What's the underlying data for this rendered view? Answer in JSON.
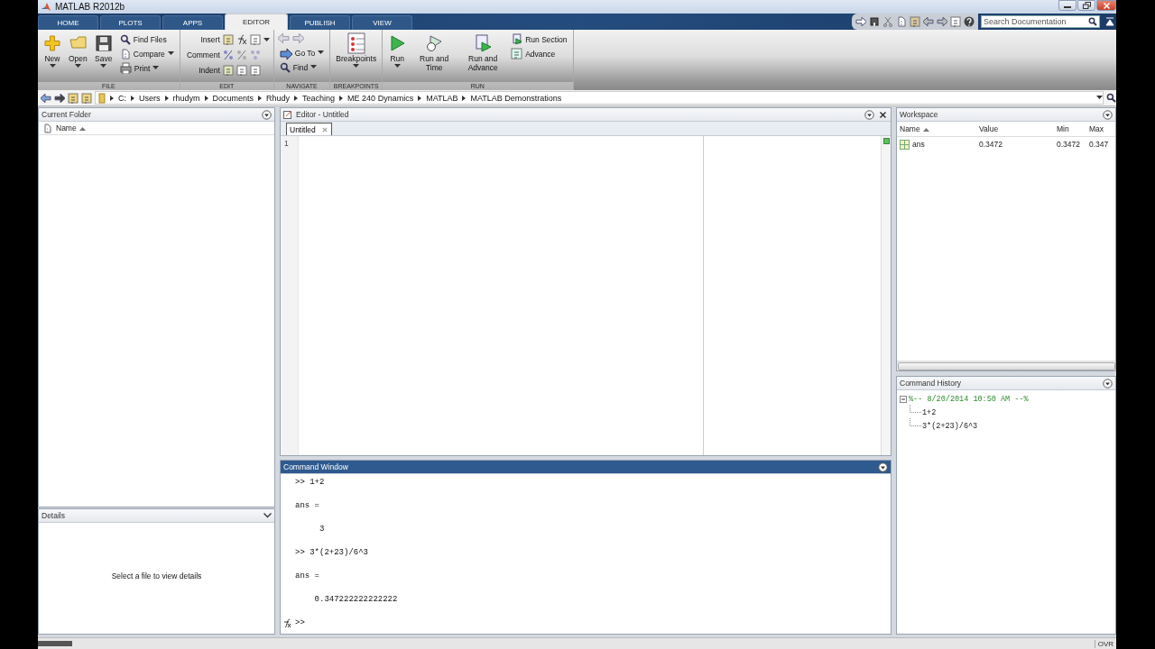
{
  "window": {
    "title": "MATLAB R2012b"
  },
  "tabs": [
    {
      "label": "HOME",
      "selected": false
    },
    {
      "label": "PLOTS",
      "selected": false
    },
    {
      "label": "APPS",
      "selected": false
    },
    {
      "label": "EDITOR",
      "selected": true
    },
    {
      "label": "PUBLISH",
      "selected": false
    },
    {
      "label": "VIEW",
      "selected": false
    }
  ],
  "search": {
    "placeholder": "Search Documentation"
  },
  "ribbon": {
    "groups": [
      {
        "label": "FILE",
        "items": [
          {
            "kind": "large",
            "label": "New",
            "caret": true
          },
          {
            "kind": "large",
            "label": "Open",
            "caret": true
          },
          {
            "kind": "large",
            "label": "Save",
            "caret": true
          },
          {
            "kind": "stack",
            "items": [
              {
                "label": "Find Files",
                "caret": false
              },
              {
                "label": "Compare",
                "caret": true
              },
              {
                "label": "Print",
                "caret": true
              }
            ]
          }
        ]
      },
      {
        "label": "EDIT",
        "items": [
          {
            "kind": "rows",
            "items": [
              {
                "label": "Insert",
                "caret": true
              },
              {
                "label": "Comment",
                "caret": false
              },
              {
                "label": "Indent",
                "caret": false
              }
            ]
          }
        ]
      },
      {
        "label": "NAVIGATE",
        "items": [
          {
            "kind": "stack",
            "items": [
              {
                "label": "Go To",
                "caret": true
              },
              {
                "label": "Find",
                "caret": true
              }
            ]
          }
        ]
      },
      {
        "label": "BREAKPOINTS",
        "items": [
          {
            "kind": "large",
            "label": "Breakpoints",
            "caret": true
          }
        ]
      },
      {
        "label": "RUN",
        "items": [
          {
            "kind": "large",
            "label": "Run",
            "caret": true
          },
          {
            "kind": "large",
            "label": "Run and Time",
            "caret": false
          },
          {
            "kind": "large",
            "label": "Run and Advance",
            "caret": false
          },
          {
            "kind": "stack",
            "items": [
              {
                "label": "Run Section",
                "caret": false
              },
              {
                "label": "Advance",
                "caret": false
              }
            ]
          }
        ]
      }
    ]
  },
  "address_bar": {
    "path": [
      "C:",
      "Users",
      "rhudym",
      "Documents",
      "Rhudy",
      "Teaching",
      "ME 240 Dynamics",
      "MATLAB",
      "MATLAB Demonstrations"
    ]
  },
  "current_folder": {
    "title": "Current Folder",
    "columns": [
      {
        "label": "Name",
        "sorted": true
      }
    ]
  },
  "details": {
    "title": "Details",
    "message": "Select a file to view details"
  },
  "editor": {
    "title": "Editor - Untitled",
    "tabs": [
      {
        "label": "Untitled",
        "selected": true
      }
    ],
    "line_numbers": [
      "1"
    ]
  },
  "command_window": {
    "title": "Command Window",
    "lines": [
      ">> 1+2",
      "ans =",
      "     3",
      ">> 3*(2+23)/6^3",
      "ans =",
      "    0.347222222222222"
    ],
    "prompt": ">>"
  },
  "workspace": {
    "title": "Workspace",
    "columns": [
      {
        "label": "Name",
        "sorted": true
      },
      {
        "label": "Value",
        "sorted": false
      },
      {
        "label": "Min",
        "sorted": false
      },
      {
        "label": "Max",
        "sorted": false
      }
    ],
    "rows": [
      {
        "cells": [
          "ans",
          "0.3472",
          "0.3472",
          "0.347"
        ]
      }
    ]
  },
  "command_history": {
    "title": "Command History",
    "sessions": [
      {
        "label": "%-- 8/20/2014 10:50 AM --%",
        "expanded": true,
        "children": [
          "1+2",
          "3*(2+23)/6^3"
        ]
      }
    ]
  },
  "status_bar": {
    "indicator": "OVR"
  }
}
